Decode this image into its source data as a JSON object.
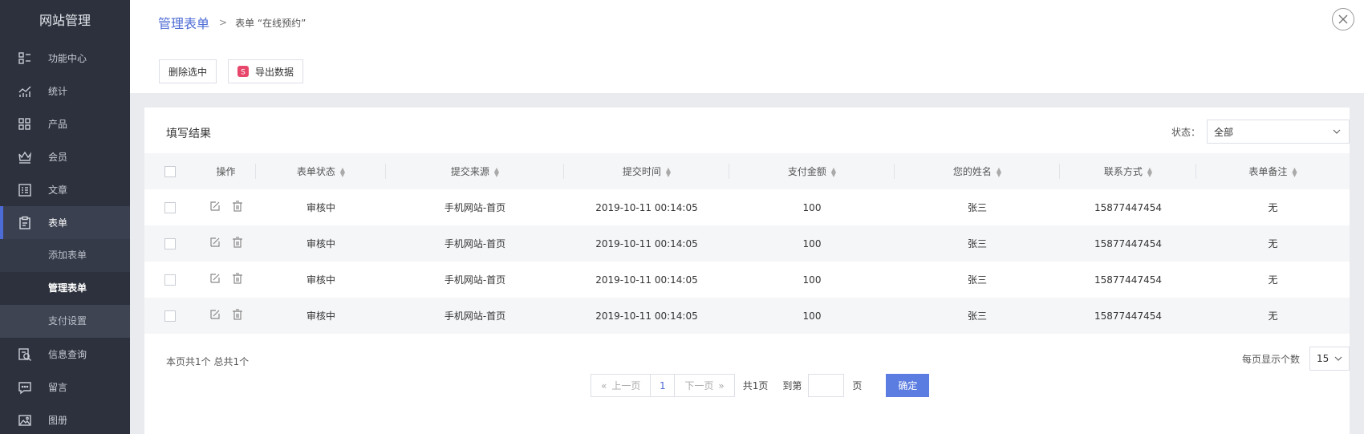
{
  "sidebar": {
    "brand": "网站管理",
    "items": [
      {
        "label": "功能中心",
        "icon": "function-center-icon"
      },
      {
        "label": "统计",
        "icon": "statistics-icon"
      },
      {
        "label": "产品",
        "icon": "product-icon"
      },
      {
        "label": "会员",
        "icon": "member-icon"
      },
      {
        "label": "文章",
        "icon": "article-icon"
      },
      {
        "label": "表单",
        "icon": "form-icon"
      }
    ],
    "sub_items": [
      {
        "label": "添加表单"
      },
      {
        "label": "管理表单"
      },
      {
        "label": "支付设置"
      }
    ],
    "items_after": [
      {
        "label": "信息查询",
        "icon": "info-query-icon"
      },
      {
        "label": "留言",
        "icon": "message-icon"
      },
      {
        "label": "图册",
        "icon": "album-icon"
      }
    ]
  },
  "header": {
    "breadcrumb_main": "管理表单",
    "breadcrumb_sep": ">",
    "breadcrumb_sub": "表单 “在线预约”"
  },
  "toolbar": {
    "delete_selected": "删除选中",
    "export_data": "导出数据"
  },
  "card": {
    "title": "填写结果",
    "status_label": "状态：",
    "status_value": "全部"
  },
  "table": {
    "columns": [
      "操作",
      "表单状态",
      "提交来源",
      "提交时间",
      "支付金额",
      "您的姓名",
      "联系方式",
      "表单备注"
    ],
    "rows": [
      {
        "status": "审核中",
        "source": "手机网站-首页",
        "time": "2019-10-11 00:14:05",
        "amount": "100",
        "name": "张三",
        "phone": "15877447454",
        "remark": "无"
      },
      {
        "status": "审核中",
        "source": "手机网站-首页",
        "time": "2019-10-11 00:14:05",
        "amount": "100",
        "name": "张三",
        "phone": "15877447454",
        "remark": "无"
      },
      {
        "status": "审核中",
        "source": "手机网站-首页",
        "time": "2019-10-11 00:14:05",
        "amount": "100",
        "name": "张三",
        "phone": "15877447454",
        "remark": "无"
      },
      {
        "status": "审核中",
        "source": "手机网站-首页",
        "time": "2019-10-11 00:14:05",
        "amount": "100",
        "name": "张三",
        "phone": "15877447454",
        "remark": "无"
      }
    ]
  },
  "pagination": {
    "info": "本页共1个 总共1个",
    "prev": "上一页",
    "current_page": "1",
    "next": "下一页",
    "total_pages": "共1页",
    "goto_label": "到第",
    "page_unit": "页",
    "confirm": "确定",
    "per_page_label": "每页显示个数",
    "per_page_value": "15"
  },
  "colors": {
    "accent": "#4d6bd6",
    "sidebar_bg": "#2c313d",
    "export_icon": "#e8476c"
  }
}
